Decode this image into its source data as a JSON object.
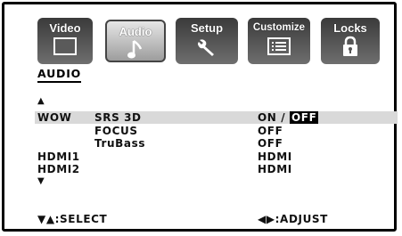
{
  "tabs": [
    {
      "label": "Video",
      "icon": "monitor-icon",
      "active": false
    },
    {
      "label": "Audio",
      "icon": "music-note-icon",
      "active": true
    },
    {
      "label": "Setup",
      "icon": "wrench-icon",
      "active": false
    },
    {
      "label": "Customize",
      "icon": "list-icon",
      "active": false
    },
    {
      "label": "Locks",
      "icon": "lock-icon",
      "active": false
    }
  ],
  "menu": {
    "heading": "AUDIO",
    "up_arrow": "▲",
    "down_arrow": "▼",
    "rows": [
      {
        "group": "WOW",
        "item": "SRS 3D",
        "value_on": "ON",
        "value_sep": " / ",
        "value_off": "OFF"
      },
      {
        "group": "",
        "item": "FOCUS",
        "value": "OFF"
      },
      {
        "group": "",
        "item": "TruBass",
        "value": "OFF"
      },
      {
        "group": "HDMI1",
        "item": "",
        "value": "HDMI"
      },
      {
        "group": "HDMI2",
        "item": "",
        "value": "HDMI"
      }
    ]
  },
  "footer": {
    "select_hint": "▼▲:SELECT",
    "adjust_hint": "◀▶:ADJUST"
  },
  "colors": {
    "highlight": "#d9d9d9",
    "tab_dark": "#4a4a4a",
    "tab_active": "#c8c8c8"
  }
}
